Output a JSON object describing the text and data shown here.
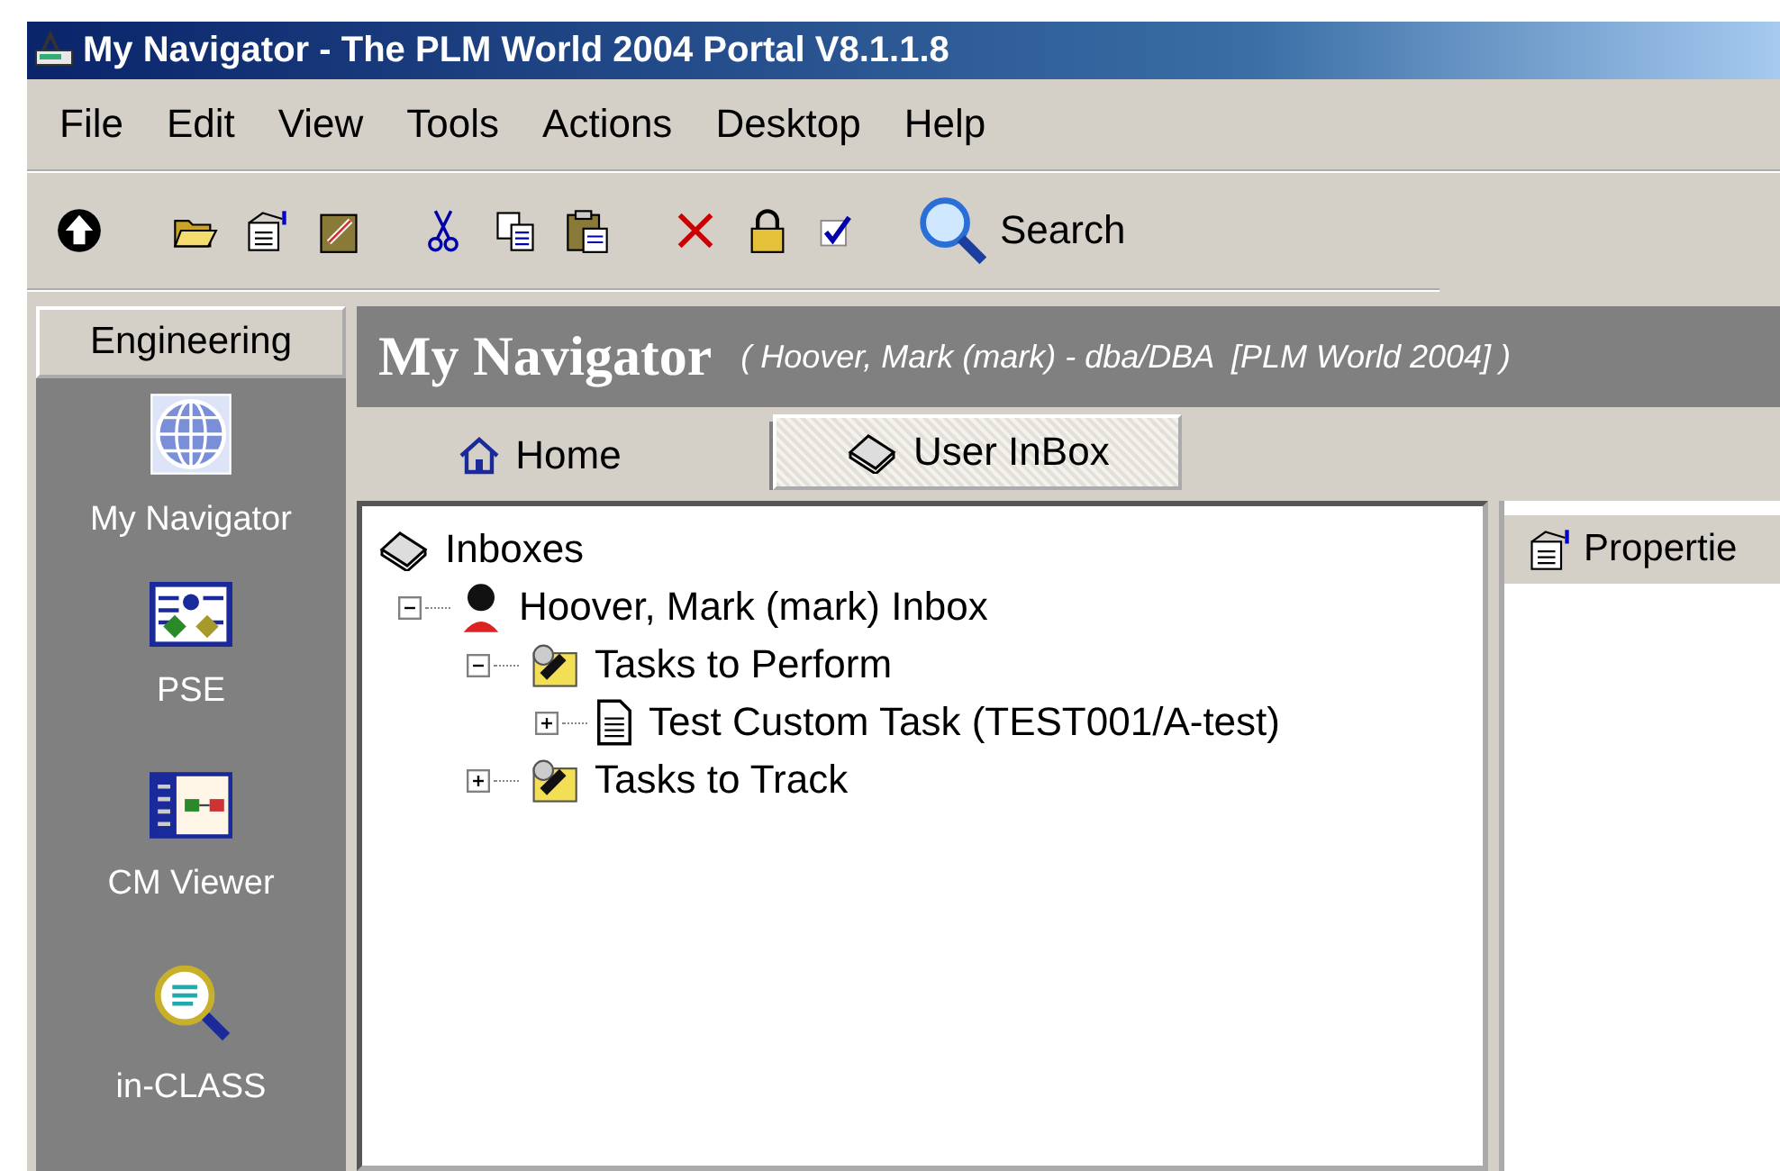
{
  "window": {
    "title": "My Navigator - The PLM World 2004 Portal V8.1.1.8"
  },
  "menu": [
    "File",
    "Edit",
    "View",
    "Tools",
    "Actions",
    "Desktop",
    "Help"
  ],
  "toolbar": [
    {
      "kind": "up"
    },
    {
      "kind": "open"
    },
    {
      "kind": "properties"
    },
    {
      "kind": "clipboard-edit"
    },
    {
      "kind": "cut"
    },
    {
      "kind": "copy"
    },
    {
      "kind": "paste"
    },
    {
      "kind": "delete"
    },
    {
      "kind": "lock"
    },
    {
      "kind": "check"
    },
    {
      "kind": "search",
      "label": "Search"
    }
  ],
  "sidebar": {
    "group": "Engineering",
    "items": [
      {
        "label": "My Navigator",
        "kind": "globe"
      },
      {
        "label": "PSE",
        "kind": "structure"
      },
      {
        "label": "CM Viewer",
        "kind": "viewer"
      },
      {
        "label": "in-CLASS",
        "kind": "magnifier"
      }
    ]
  },
  "header": {
    "title": "My Navigator",
    "subtitle": "( Hoover, Mark (mark) - dba/DBA  [PLM World 2004] )"
  },
  "tabs": [
    {
      "label": "Home",
      "kind": "home",
      "selected": false
    },
    {
      "label": "User InBox",
      "kind": "inbox",
      "selected": true
    }
  ],
  "tree": [
    {
      "label": "Inboxes",
      "kind": "inbox",
      "children": [
        {
          "label": "Hoover, Mark (mark) Inbox",
          "kind": "user",
          "expanded": true,
          "children": [
            {
              "label": "Tasks to Perform",
              "kind": "tasks",
              "expanded": true,
              "children": [
                {
                  "label": "Test Custom Task (TEST001/A-test)",
                  "kind": "document",
                  "expanded": false
                }
              ]
            },
            {
              "label": "Tasks to Track",
              "kind": "tasks",
              "expanded": false
            }
          ]
        }
      ]
    }
  ],
  "properties_tab": {
    "label": "Propertie"
  }
}
